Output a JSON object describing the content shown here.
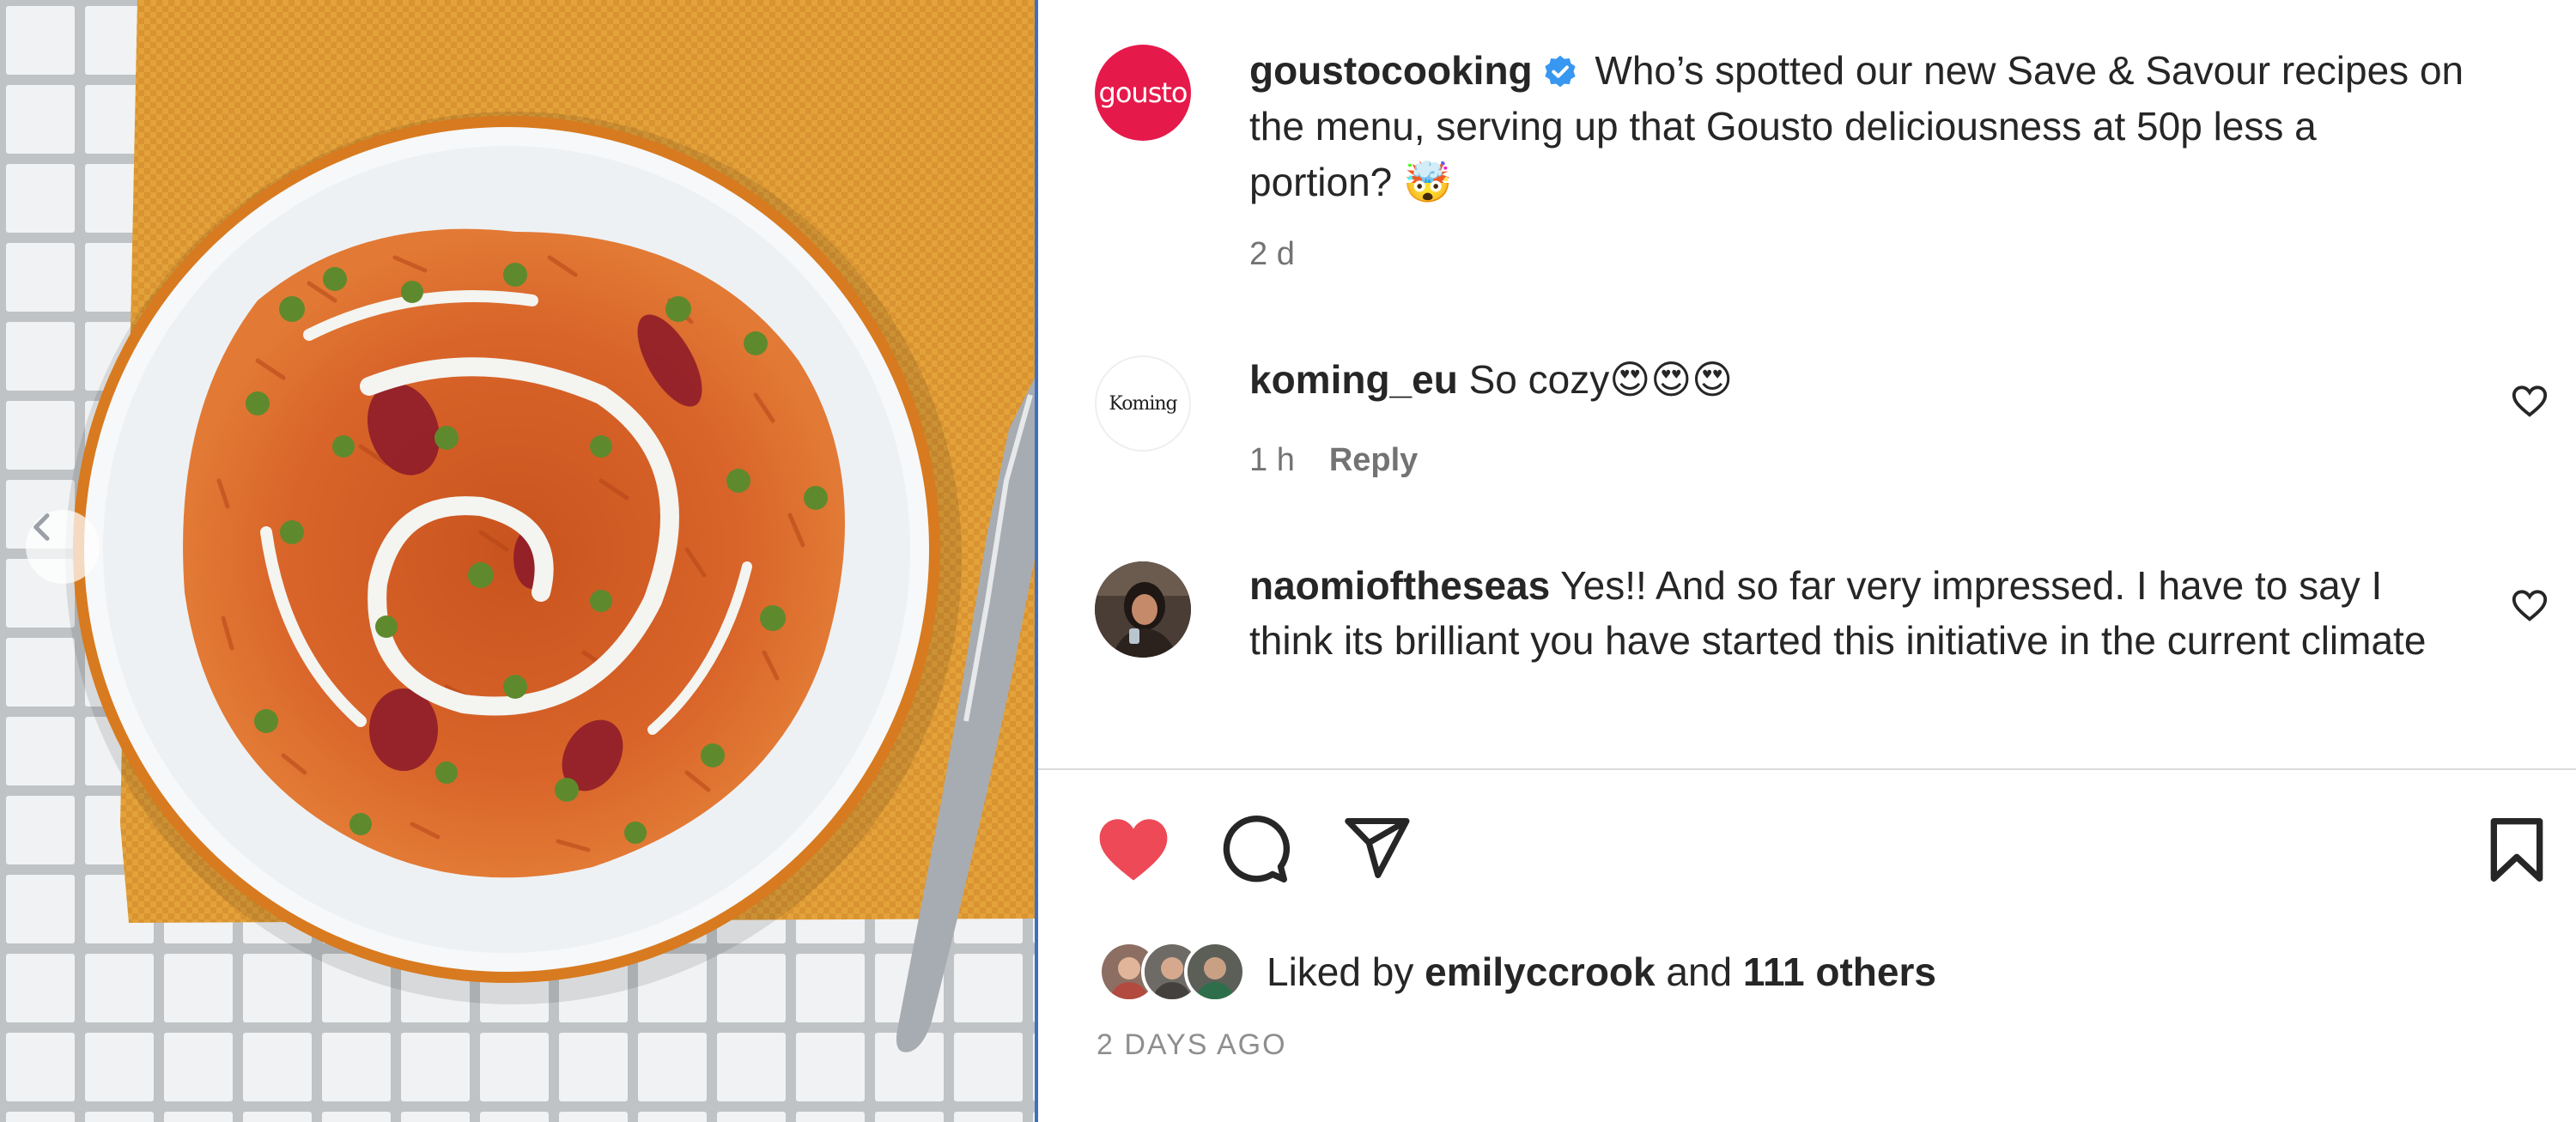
{
  "post": {
    "author": "goustocooking",
    "author_avatar_text": "gousto",
    "caption": "Who’s spotted our new Save & Savour recipes on the menu, serving up that Gousto deliciousness at 50p less a portion? 🤯",
    "age": "2 d"
  },
  "comments": [
    {
      "username": "koming_eu",
      "avatar_text": "Koming",
      "text": "So cozy😍😍😍",
      "age": "1 h",
      "reply_label": "Reply"
    },
    {
      "username": "naomioftheseas",
      "text": "Yes!! And so far very impressed. I have to say I think its brilliant you have started this initiative in the current climate"
    }
  ],
  "likes": {
    "prefix": "Liked by",
    "user": "emilyccrook",
    "joiner": "and",
    "others": "111 others"
  },
  "post_date": "2 DAYS AGO",
  "icons": {
    "like": "heart-filled-icon",
    "comment": "comment-bubble-icon",
    "share": "paper-plane-icon",
    "save": "bookmark-icon",
    "verified": "verified-badge-icon",
    "carousel_prev": "chevron-left-icon"
  },
  "colors": {
    "like_red": "#ed4956",
    "verified_blue": "#3897f0",
    "gousto_brand": "#e6194b",
    "muted_text": "#737373"
  }
}
